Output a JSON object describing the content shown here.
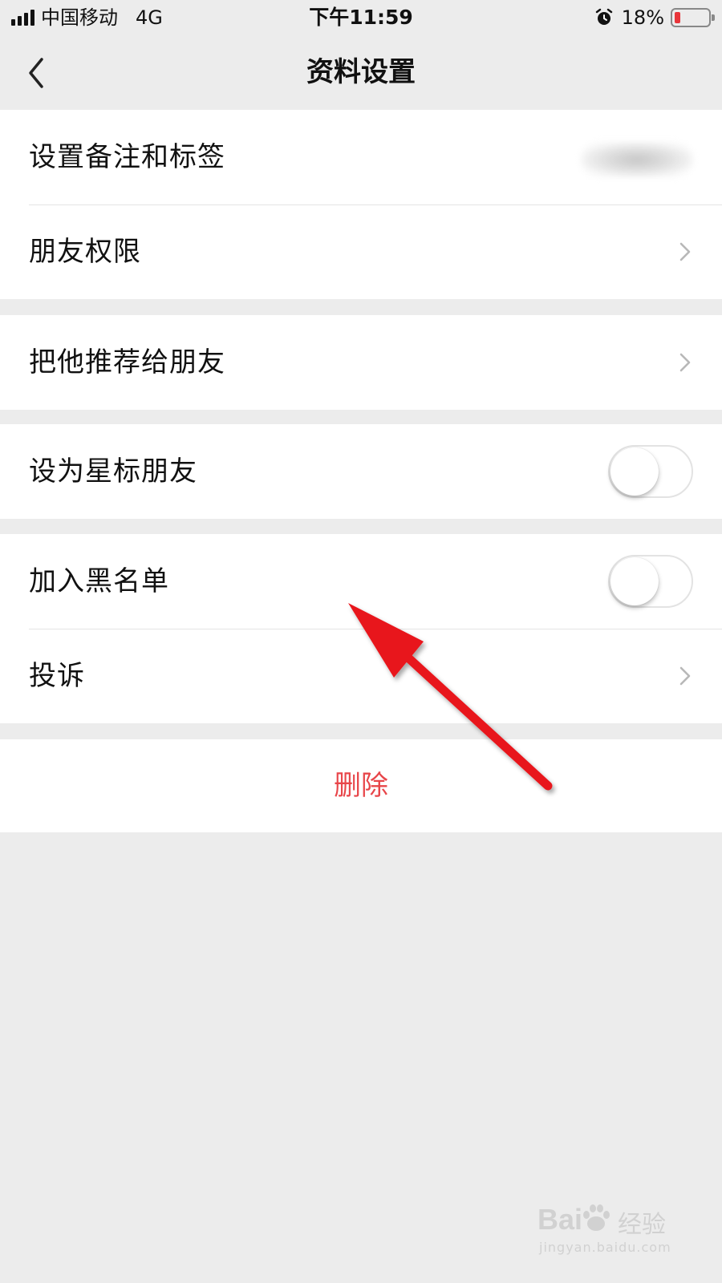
{
  "status_bar": {
    "carrier": "中国移动",
    "network": "4G",
    "time": "下午11:59",
    "battery_percent": "18%",
    "battery_level": 0.18,
    "battery_color": "#e8353a",
    "icons": [
      "signal-icon",
      "alarm-icon",
      "battery-icon"
    ]
  },
  "nav": {
    "title": "资料设置",
    "back_icon": "chevron-left-icon"
  },
  "groups": [
    {
      "items": [
        {
          "label": "设置备注和标签",
          "accessory": "blurred-value"
        },
        {
          "label": "朋友权限",
          "accessory": "chevron-right-icon"
        }
      ]
    },
    {
      "items": [
        {
          "label": "把他推荐给朋友",
          "accessory": "chevron-right-icon"
        }
      ]
    },
    {
      "items": [
        {
          "label": "设为星标朋友",
          "accessory": "toggle",
          "toggle_on": false
        }
      ]
    },
    {
      "items": [
        {
          "label": "加入黑名单",
          "accessory": "toggle",
          "toggle_on": false
        },
        {
          "label": "投诉",
          "accessory": "chevron-right-icon"
        }
      ]
    }
  ],
  "delete": {
    "label": "删除",
    "color": "#e8464a"
  },
  "annotation": {
    "icon": "red-arrow-annotation",
    "color": "#e8161c"
  },
  "watermark": {
    "logo": "Bai",
    "logo_icon": "baidu-paw-icon",
    "brand": "经验",
    "url": "jingyan.baidu.com"
  }
}
